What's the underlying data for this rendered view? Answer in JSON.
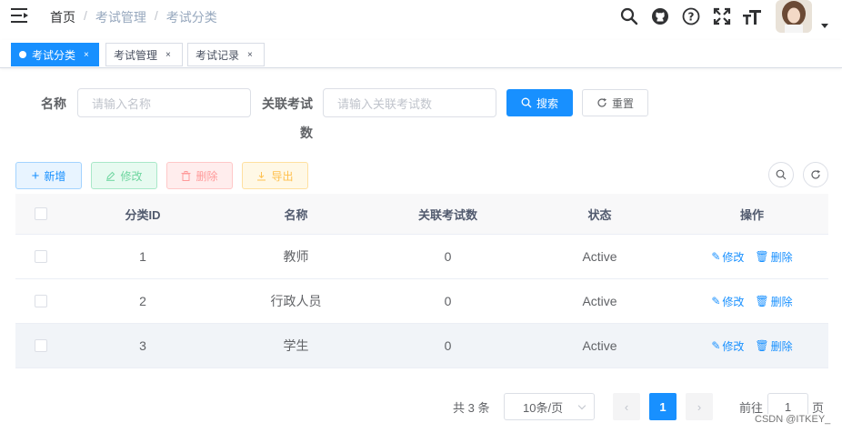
{
  "navbar": {
    "breadcrumb": [
      "首页",
      "考试管理",
      "考试分类"
    ],
    "icons": [
      "search-icon",
      "github-icon",
      "help-icon",
      "fullscreen-icon",
      "font-size-icon"
    ]
  },
  "tags": [
    {
      "label": "考试分类",
      "active": true
    },
    {
      "label": "考试管理",
      "active": false
    },
    {
      "label": "考试记录",
      "active": false
    }
  ],
  "search_form": {
    "name_label": "名称",
    "name_placeholder": "请输入名称",
    "count_label_line1": "关联考试",
    "count_label_line2": "数",
    "count_placeholder": "请输入关联考试数",
    "search_button": "搜索",
    "reset_button": "重置"
  },
  "toolbar": {
    "add": "新增",
    "edit": "修改",
    "delete": "删除",
    "export": "导出"
  },
  "table": {
    "columns": [
      "分类ID",
      "名称",
      "关联考试数",
      "状态",
      "操作"
    ],
    "rows": [
      {
        "id": "1",
        "name": "教师",
        "count": "0",
        "status": "Active",
        "edit": "修改",
        "delete": "删除"
      },
      {
        "id": "2",
        "name": "行政人员",
        "count": "0",
        "status": "Active",
        "edit": "修改",
        "delete": "删除"
      },
      {
        "id": "3",
        "name": "学生",
        "count": "0",
        "status": "Active",
        "edit": "修改",
        "delete": "删除"
      }
    ]
  },
  "pagination": {
    "total": "共 3 条",
    "page_size": "10条/页",
    "current_page": "1",
    "jump_prefix": "前往",
    "jump_value": "1",
    "jump_suffix": "页"
  },
  "watermark": "CSDN @ITKEY_",
  "colors": {
    "primary": "#1890ff",
    "success": "#13ce66",
    "danger": "#ff4949",
    "warning": "#ffba00"
  }
}
